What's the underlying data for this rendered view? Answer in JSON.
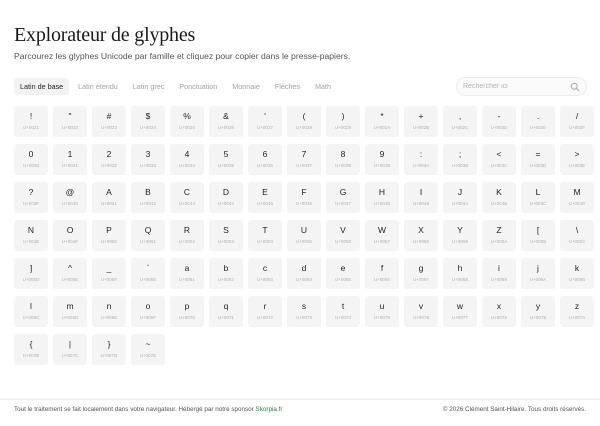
{
  "header": {
    "title": "Explorateur de glyphes",
    "subtitle": "Parcourez les glyphes Unicode par famille et cliquez pour copier dans le presse-papiers."
  },
  "tabs": [
    {
      "label": "Latin de base",
      "active": true
    },
    {
      "label": "Latin étendu",
      "active": false
    },
    {
      "label": "Latin grec",
      "active": false
    },
    {
      "label": "Ponctuation",
      "active": false
    },
    {
      "label": "Monnaie",
      "active": false
    },
    {
      "label": "Flèches",
      "active": false
    },
    {
      "label": "Math",
      "active": false
    }
  ],
  "search": {
    "placeholder": "Rechercher ici",
    "value": "",
    "icon": "search-icon"
  },
  "glyphs": [
    {
      "char": "!",
      "code": "U+0021"
    },
    {
      "char": "\"",
      "code": "U+0022"
    },
    {
      "char": "#",
      "code": "U+0023"
    },
    {
      "char": "$",
      "code": "U+0024"
    },
    {
      "char": "%",
      "code": "U+0025"
    },
    {
      "char": "&",
      "code": "U+0026"
    },
    {
      "char": "'",
      "code": "U+0027"
    },
    {
      "char": "(",
      "code": "U+0028"
    },
    {
      "char": ")",
      "code": "U+0029"
    },
    {
      "char": "*",
      "code": "U+002A"
    },
    {
      "char": "+",
      "code": "U+002B"
    },
    {
      "char": ",",
      "code": "U+002C"
    },
    {
      "char": "-",
      "code": "U+002D"
    },
    {
      "char": ".",
      "code": "U+002E"
    },
    {
      "char": "/",
      "code": "U+002F"
    },
    {
      "char": "0",
      "code": "U+0030"
    },
    {
      "char": "1",
      "code": "U+0031"
    },
    {
      "char": "2",
      "code": "U+0032"
    },
    {
      "char": "3",
      "code": "U+0033"
    },
    {
      "char": "4",
      "code": "U+0034"
    },
    {
      "char": "5",
      "code": "U+0035"
    },
    {
      "char": "6",
      "code": "U+0036"
    },
    {
      "char": "7",
      "code": "U+0037"
    },
    {
      "char": "8",
      "code": "U+0038"
    },
    {
      "char": "9",
      "code": "U+0039"
    },
    {
      "char": ":",
      "code": "U+003A"
    },
    {
      "char": ";",
      "code": "U+003B"
    },
    {
      "char": "<",
      "code": "U+003C"
    },
    {
      "char": "=",
      "code": "U+003D"
    },
    {
      "char": ">",
      "code": "U+003E"
    },
    {
      "char": "?",
      "code": "U+003F"
    },
    {
      "char": "@",
      "code": "U+0040"
    },
    {
      "char": "A",
      "code": "U+0041"
    },
    {
      "char": "B",
      "code": "U+0042"
    },
    {
      "char": "C",
      "code": "U+0043"
    },
    {
      "char": "D",
      "code": "U+0044"
    },
    {
      "char": "E",
      "code": "U+0045"
    },
    {
      "char": "F",
      "code": "U+0046"
    },
    {
      "char": "G",
      "code": "U+0047"
    },
    {
      "char": "H",
      "code": "U+0048"
    },
    {
      "char": "I",
      "code": "U+0049"
    },
    {
      "char": "J",
      "code": "U+004A"
    },
    {
      "char": "K",
      "code": "U+004B"
    },
    {
      "char": "L",
      "code": "U+004C"
    },
    {
      "char": "M",
      "code": "U+004D"
    },
    {
      "char": "N",
      "code": "U+004E"
    },
    {
      "char": "O",
      "code": "U+004F"
    },
    {
      "char": "P",
      "code": "U+0050"
    },
    {
      "char": "Q",
      "code": "U+0051"
    },
    {
      "char": "R",
      "code": "U+0052"
    },
    {
      "char": "S",
      "code": "U+0053"
    },
    {
      "char": "T",
      "code": "U+0054"
    },
    {
      "char": "U",
      "code": "U+0055"
    },
    {
      "char": "V",
      "code": "U+0056"
    },
    {
      "char": "W",
      "code": "U+0057"
    },
    {
      "char": "X",
      "code": "U+0058"
    },
    {
      "char": "Y",
      "code": "U+0059"
    },
    {
      "char": "Z",
      "code": "U+005A"
    },
    {
      "char": "[",
      "code": "U+005B"
    },
    {
      "char": "\\",
      "code": "U+005C"
    },
    {
      "char": "]",
      "code": "U+005D"
    },
    {
      "char": "^",
      "code": "U+005E"
    },
    {
      "char": "_",
      "code": "U+005F"
    },
    {
      "char": "`",
      "code": "U+0060"
    },
    {
      "char": "a",
      "code": "U+0061"
    },
    {
      "char": "b",
      "code": "U+0062"
    },
    {
      "char": "c",
      "code": "U+0063"
    },
    {
      "char": "d",
      "code": "U+0064"
    },
    {
      "char": "e",
      "code": "U+0065"
    },
    {
      "char": "f",
      "code": "U+0066"
    },
    {
      "char": "g",
      "code": "U+0067"
    },
    {
      "char": "h",
      "code": "U+0068"
    },
    {
      "char": "i",
      "code": "U+0069"
    },
    {
      "char": "j",
      "code": "U+006A"
    },
    {
      "char": "k",
      "code": "U+006B"
    },
    {
      "char": "l",
      "code": "U+006C"
    },
    {
      "char": "m",
      "code": "U+006D"
    },
    {
      "char": "n",
      "code": "U+006E"
    },
    {
      "char": "o",
      "code": "U+006F"
    },
    {
      "char": "p",
      "code": "U+0070"
    },
    {
      "char": "q",
      "code": "U+0071"
    },
    {
      "char": "r",
      "code": "U+0072"
    },
    {
      "char": "s",
      "code": "U+0073"
    },
    {
      "char": "t",
      "code": "U+0074"
    },
    {
      "char": "u",
      "code": "U+0075"
    },
    {
      "char": "v",
      "code": "U+0076"
    },
    {
      "char": "w",
      "code": "U+0077"
    },
    {
      "char": "x",
      "code": "U+0078"
    },
    {
      "char": "y",
      "code": "U+0079"
    },
    {
      "char": "z",
      "code": "U+007A"
    },
    {
      "char": "{",
      "code": "U+007B"
    },
    {
      "char": "|",
      "code": "U+007C"
    },
    {
      "char": "}",
      "code": "U+007D"
    },
    {
      "char": "~",
      "code": "U+007E"
    }
  ],
  "footer": {
    "left_text": "Tout le traitement se fait localement dans votre navigateur. Hébergé par notre sponsor ",
    "sponsor": "Skorpia.fr",
    "right_text": "© 2026 Clément Saint-Hilaire. Tous droits réservés."
  },
  "colors": {
    "accent_link": "#2e7d32",
    "tile_bg": "#f4f4f4",
    "active_tab_bg": "#f2f2f2"
  }
}
